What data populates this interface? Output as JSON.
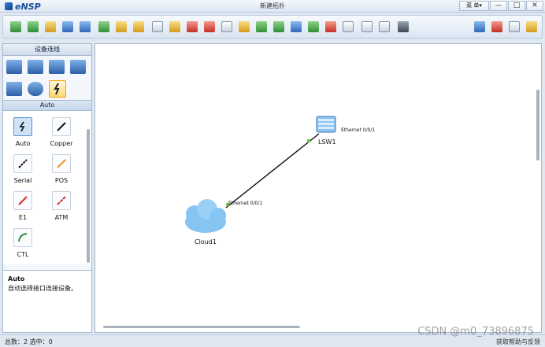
{
  "app": {
    "logo_text": "eNSP",
    "window_title": "新建拓扑",
    "menu_label": "菜 单▾",
    "minimize": "—",
    "maximize": "□",
    "close": "✕"
  },
  "toolbar": {
    "icons": [
      "new-topology",
      "open-topology",
      "save-as",
      "save",
      "print",
      "undo",
      "redo",
      "select",
      "pan",
      "delete",
      "delete-all-links",
      "text",
      "rectangle",
      "zoom-in",
      "zoom-out",
      "fit",
      "start-device",
      "stop-device",
      "capture",
      "device-table",
      "topology-table",
      "terminal",
      "chat",
      "huawei",
      "settings",
      "help"
    ]
  },
  "left_panel": {
    "title": "设备连线",
    "category_title": "Auto",
    "cables": [
      {
        "label": "Auto"
      },
      {
        "label": "Copper"
      },
      {
        "label": "Serial"
      },
      {
        "label": "POS"
      },
      {
        "label": "E1"
      },
      {
        "label": "ATM"
      },
      {
        "label": "CTL"
      }
    ],
    "description": {
      "heading": "Auto",
      "text": "自动选择接口连接设备。"
    }
  },
  "topology": {
    "nodes": [
      {
        "name": "LSW1",
        "type": "switch"
      },
      {
        "name": "Cloud1",
        "type": "cloud"
      }
    ],
    "link": {
      "from_port": "Ethernet 0/0/1",
      "to_port": "Ethernet 0/0/1"
    }
  },
  "statusbar": {
    "left": "总数：2 选中：0",
    "right": "获取帮助与反馈"
  },
  "watermark": "CSDN @m0_73896875"
}
